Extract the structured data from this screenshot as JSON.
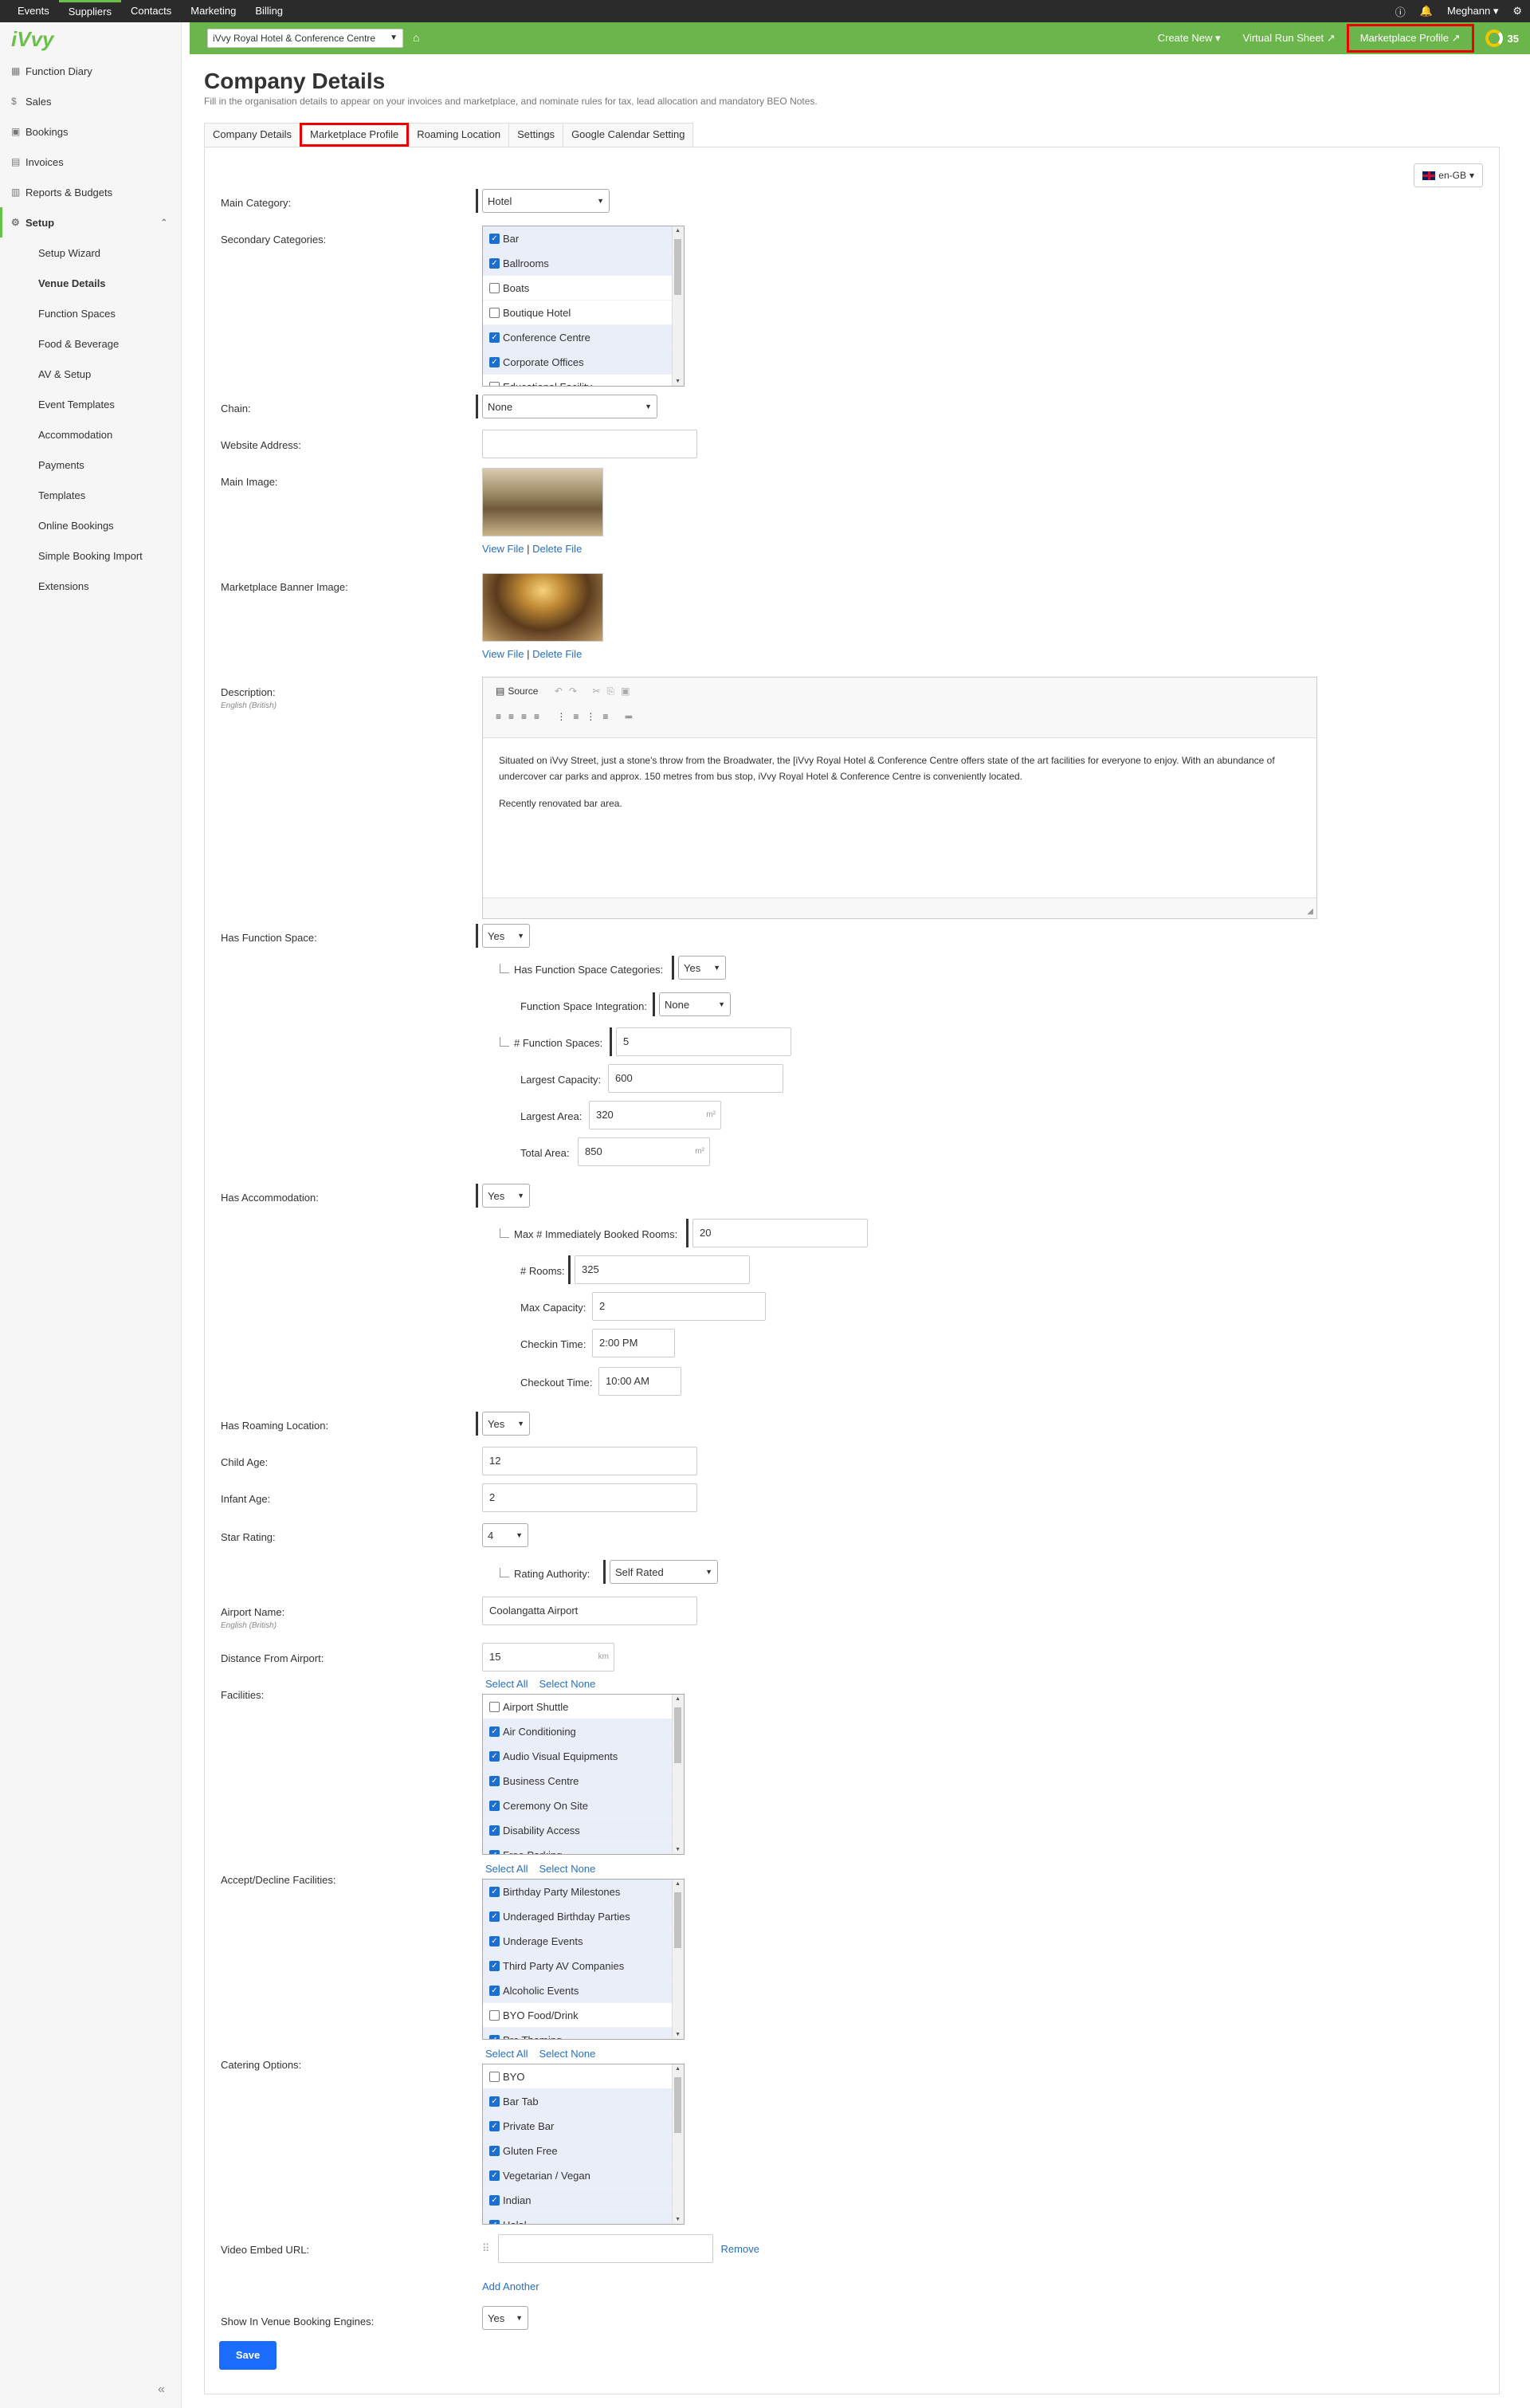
{
  "topnav": [
    "Events",
    "Suppliers",
    "Contacts",
    "Marketing",
    "Billing"
  ],
  "topnav_active": "Suppliers",
  "user": "Meghann",
  "logo": "iVvy",
  "sidebar": {
    "items": [
      "Function Diary",
      "Sales",
      "Bookings",
      "Invoices",
      "Reports & Budgets"
    ],
    "setup": "Setup",
    "sub": [
      "Setup Wizard",
      "Venue Details",
      "Function Spaces",
      "Food & Beverage",
      "AV & Setup",
      "Event Templates",
      "Accommodation",
      "Payments",
      "Templates",
      "Online Bookings",
      "Simple Booking Import",
      "Extensions"
    ],
    "collapse": "«"
  },
  "greenbar": {
    "venue": "iVvy Royal Hotel & Conference Centre",
    "create_new": "Create New",
    "virtual_run_sheet": "Virtual Run Sheet",
    "marketplace_profile": "Marketplace Profile",
    "count": "35"
  },
  "page": {
    "title": "Company Details",
    "subtitle": "Fill in the organisation details to appear on your invoices and marketplace, and nominate rules for tax, lead allocation and mandatory BEO Notes."
  },
  "tabs": [
    "Company Details",
    "Marketplace Profile",
    "Roaming Location",
    "Settings",
    "Google Calendar Setting"
  ],
  "lang": "en-GB",
  "form": {
    "main_category_label": "Main Category:",
    "main_category": "Hotel",
    "secondary_label": "Secondary Categories:",
    "secondary": [
      {
        "label": "Bar",
        "checked": true
      },
      {
        "label": "Ballrooms",
        "checked": true
      },
      {
        "label": "Boats",
        "checked": false
      },
      {
        "label": "Boutique Hotel",
        "checked": false
      },
      {
        "label": "Conference Centre",
        "checked": true
      },
      {
        "label": "Corporate Offices",
        "checked": true
      },
      {
        "label": "Educational Facility",
        "checked": false
      }
    ],
    "chain_label": "Chain:",
    "chain": "None",
    "website_label": "Website Address:",
    "website": "",
    "main_image_label": "Main Image:",
    "banner_label": "Marketplace Banner Image:",
    "view_file": "View File",
    "delete_file": "Delete File",
    "sep": "|",
    "description_label": "Description:",
    "description_lang": "English (British)",
    "source": "Source",
    "description_p1": "Situated on iVvy Street, just a stone's throw from the Broadwater, the [iVvy Royal Hotel & Conference Centre offers state of the art facilities for everyone to enjoy. With an abundance of undercover car parks and approx. 150 metres from bus stop, iVvy Royal Hotel & Conference Centre is conveniently located.",
    "description_p2": "Recently renovated bar area.",
    "has_function_space_label": "Has Function Space:",
    "has_function_space": "Yes",
    "fs_categories_label": "Has Function Space Categories:",
    "fs_categories": "Yes",
    "fs_integration_label": "Function Space Integration:",
    "fs_integration": "None",
    "fs_count_label": "# Function Spaces:",
    "fs_count": "5",
    "largest_capacity_label": "Largest Capacity:",
    "largest_capacity": "600",
    "largest_area_label": "Largest Area:",
    "largest_area": "320",
    "total_area_label": "Total Area:",
    "total_area": "850",
    "area_unit": "m²",
    "has_accommodation_label": "Has Accommodation:",
    "has_accommodation": "Yes",
    "max_booked_label": "Max # Immediately Booked Rooms:",
    "max_booked": "20",
    "rooms_label": "# Rooms:",
    "rooms": "325",
    "max_capacity_label": "Max Capacity:",
    "max_capacity": "2",
    "checkin_label": "Checkin Time:",
    "checkin": "2:00 PM",
    "checkout_label": "Checkout Time:",
    "checkout": "10:00 AM",
    "has_roaming_label": "Has Roaming Location:",
    "has_roaming": "Yes",
    "child_age_label": "Child Age:",
    "child_age": "12",
    "infant_age_label": "Infant Age:",
    "infant_age": "2",
    "star_rating_label": "Star Rating:",
    "star_rating": "4",
    "rating_authority_label": "Rating Authority:",
    "rating_authority": "Self Rated",
    "airport_label": "Airport Name:",
    "airport_lang": "English (British)",
    "airport": "Coolangatta Airport",
    "distance_label": "Distance From Airport:",
    "distance": "15",
    "distance_unit": "km",
    "select_all": "Select All",
    "select_none": "Select None",
    "facilities_label": "Facilities:",
    "facilities": [
      {
        "label": "Airport Shuttle",
        "checked": false
      },
      {
        "label": "Air Conditioning",
        "checked": true
      },
      {
        "label": "Audio Visual Equipments",
        "checked": true
      },
      {
        "label": "Business Centre",
        "checked": true
      },
      {
        "label": "Ceremony On Site",
        "checked": true
      },
      {
        "label": "Disability Access",
        "checked": true
      },
      {
        "label": "Free Parking",
        "checked": true
      }
    ],
    "accept_label": "Accept/Decline Facilities:",
    "accept": [
      {
        "label": "Birthday Party Milestones",
        "checked": true
      },
      {
        "label": "Underaged Birthday Parties",
        "checked": true
      },
      {
        "label": "Underage Events",
        "checked": true
      },
      {
        "label": "Third Party AV Companies",
        "checked": true
      },
      {
        "label": "Alcoholic Events",
        "checked": true
      },
      {
        "label": "BYO Food/Drink",
        "checked": false
      },
      {
        "label": "Pre Theming",
        "checked": true
      }
    ],
    "catering_label": "Catering Options:",
    "catering": [
      {
        "label": "BYO",
        "checked": false
      },
      {
        "label": "Bar Tab",
        "checked": true
      },
      {
        "label": "Private Bar",
        "checked": true
      },
      {
        "label": "Gluten Free",
        "checked": true
      },
      {
        "label": "Vegetarian / Vegan",
        "checked": true
      },
      {
        "label": "Indian",
        "checked": true
      },
      {
        "label": "Halal",
        "checked": true
      }
    ],
    "video_label": "Video Embed URL:",
    "video": "",
    "remove": "Remove",
    "add_another": "Add Another",
    "show_booking_label": "Show In Venue Booking Engines:",
    "show_booking": "Yes",
    "save": "Save"
  }
}
